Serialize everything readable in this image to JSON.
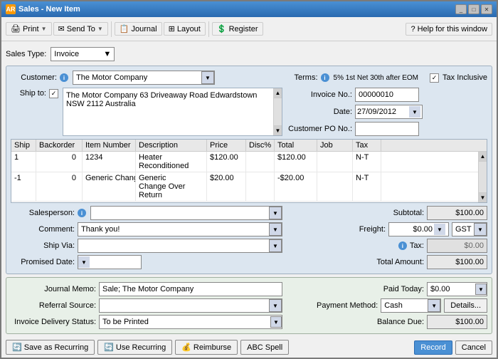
{
  "window": {
    "title": "Sales - New Item",
    "icon_label": "AR"
  },
  "toolbar": {
    "print_label": "Print",
    "send_to_label": "Send To",
    "journal_label": "Journal",
    "layout_label": "Layout",
    "register_label": "Register",
    "help_label": "Help for this window"
  },
  "sales_type": {
    "label": "Sales Type:",
    "value": "Invoice"
  },
  "form": {
    "customer_label": "Customer:",
    "customer_value": "The Motor Company",
    "terms_label": "Terms:",
    "terms_value": "5% 1st Net 30th after EOM",
    "tax_inclusive_label": "Tax Inclusive",
    "ship_to_label": "Ship to:",
    "ship_to_checked": true,
    "ship_to_address": "The Motor Company\n63 Driveaway Road\nEdwardstown NSW  2112\nAustralia",
    "invoice_no_label": "Invoice No.:",
    "invoice_no_value": "00000010",
    "date_label": "Date:",
    "date_value": "27/09/2012",
    "customer_po_label": "Customer PO No.:",
    "grid": {
      "columns": [
        "Ship",
        "Backorder",
        "Item Number",
        "Description",
        "Price",
        "Disc%",
        "Total",
        "Job",
        "Tax"
      ],
      "rows": [
        {
          "ship": "1",
          "backorder": "0",
          "item": "1234",
          "description": "Heater Reconditioned",
          "price": "$120.00",
          "disc": "",
          "total": "$120.00",
          "job": "",
          "tax": "N-T"
        },
        {
          "ship": "-1",
          "backorder": "0",
          "item": "Generic Chang",
          "description": "Generic Change Over Return",
          "price": "$20.00",
          "disc": "",
          "total": "-$20.00",
          "job": "",
          "tax": "N-T"
        }
      ]
    },
    "salesperson_label": "Salesperson:",
    "comment_label": "Comment:",
    "comment_value": "Thank you!",
    "ship_via_label": "Ship Via:",
    "promised_date_label": "Promised Date:",
    "subtotal_label": "Subtotal:",
    "subtotal_value": "$100.00",
    "freight_label": "Freight:",
    "freight_value": "$0.00",
    "tax_label": "Tax:",
    "tax_value": "$0.00",
    "total_label": "Total Amount:",
    "total_value": "$100.00",
    "gst_label": "GST"
  },
  "lower": {
    "journal_memo_label": "Journal Memo:",
    "journal_memo_value": "Sale; The Motor Company",
    "referral_source_label": "Referral Source:",
    "invoice_delivery_label": "Invoice Delivery Status:",
    "invoice_delivery_value": "To be Printed",
    "paid_today_label": "Paid Today:",
    "paid_today_value": "$0.00",
    "payment_method_label": "Payment Method:",
    "payment_method_value": "Cash",
    "balance_due_label": "Balance Due:",
    "balance_due_value": "$100.00",
    "details_btn_label": "Details..."
  },
  "footer": {
    "save_recurring_label": "Save as Recurring",
    "use_recurring_label": "Use Recurring",
    "reimburse_label": "Reimburse",
    "spell_label": "Spell",
    "record_label": "Record",
    "cancel_label": "Cancel"
  }
}
